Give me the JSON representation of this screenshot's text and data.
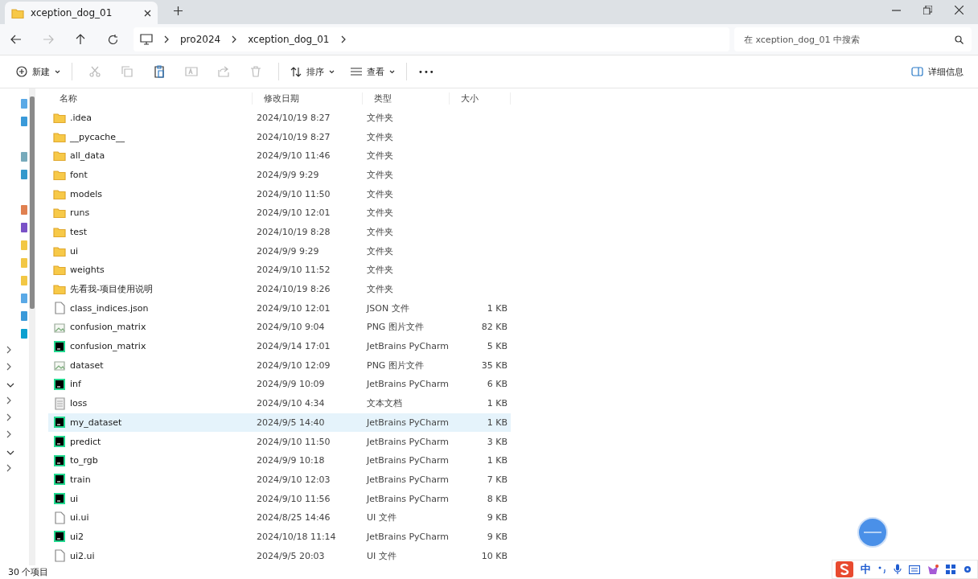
{
  "window": {
    "tab_title": "xception_dog_01"
  },
  "breadcrumb": [
    "pro2024",
    "xception_dog_01"
  ],
  "search": {
    "placeholder": "在 xception_dog_01 中搜索"
  },
  "toolbar": {
    "new": "新建",
    "sort": "排序",
    "view": "查看",
    "more": "•••",
    "details": "详细信息"
  },
  "columns": [
    "名称",
    "修改日期",
    "类型",
    "大小"
  ],
  "rows": [
    {
      "kind": "folder",
      "name": ".idea",
      "date": "2024/10/19 8:27",
      "type": "文件夹",
      "size": "",
      "selected": false
    },
    {
      "kind": "folder",
      "name": "__pycache__",
      "date": "2024/10/19 8:27",
      "type": "文件夹",
      "size": "",
      "selected": false
    },
    {
      "kind": "folder",
      "name": "all_data",
      "date": "2024/9/10 11:46",
      "type": "文件夹",
      "size": "",
      "selected": false
    },
    {
      "kind": "folder",
      "name": "font",
      "date": "2024/9/9 9:29",
      "type": "文件夹",
      "size": "",
      "selected": false
    },
    {
      "kind": "folder",
      "name": "models",
      "date": "2024/9/10 11:50",
      "type": "文件夹",
      "size": "",
      "selected": false
    },
    {
      "kind": "folder",
      "name": "runs",
      "date": "2024/9/10 12:01",
      "type": "文件夹",
      "size": "",
      "selected": false
    },
    {
      "kind": "folder",
      "name": "test",
      "date": "2024/10/19 8:28",
      "type": "文件夹",
      "size": "",
      "selected": false
    },
    {
      "kind": "folder",
      "name": "ui",
      "date": "2024/9/9 9:29",
      "type": "文件夹",
      "size": "",
      "selected": false
    },
    {
      "kind": "folder",
      "name": "weights",
      "date": "2024/9/10 11:52",
      "type": "文件夹",
      "size": "",
      "selected": false
    },
    {
      "kind": "folder",
      "name": "先看我-项目使用说明",
      "date": "2024/10/19 8:26",
      "type": "文件夹",
      "size": "",
      "selected": false
    },
    {
      "kind": "file",
      "name": "class_indices.json",
      "date": "2024/9/10 12:01",
      "type": "JSON 文件",
      "size": "1 KB",
      "selected": false
    },
    {
      "kind": "image",
      "name": "confusion_matrix",
      "date": "2024/9/10 9:04",
      "type": "PNG 图片文件",
      "size": "82 KB",
      "selected": false
    },
    {
      "kind": "python",
      "name": "confusion_matrix",
      "date": "2024/9/14 17:01",
      "type": "JetBrains PyCharm",
      "size": "5 KB",
      "selected": false
    },
    {
      "kind": "image",
      "name": "dataset",
      "date": "2024/9/10 12:09",
      "type": "PNG 图片文件",
      "size": "35 KB",
      "selected": false
    },
    {
      "kind": "python",
      "name": "inf",
      "date": "2024/9/9 10:09",
      "type": "JetBrains PyCharm",
      "size": "6 KB",
      "selected": false
    },
    {
      "kind": "text",
      "name": "loss",
      "date": "2024/9/10 4:34",
      "type": "文本文档",
      "size": "1 KB",
      "selected": false
    },
    {
      "kind": "python",
      "name": "my_dataset",
      "date": "2024/9/5 14:40",
      "type": "JetBrains PyCharm",
      "size": "1 KB",
      "selected": true
    },
    {
      "kind": "python",
      "name": "predict",
      "date": "2024/9/10 11:50",
      "type": "JetBrains PyCharm",
      "size": "3 KB",
      "selected": false
    },
    {
      "kind": "python",
      "name": "to_rgb",
      "date": "2024/9/9 10:18",
      "type": "JetBrains PyCharm",
      "size": "1 KB",
      "selected": false
    },
    {
      "kind": "python",
      "name": "train",
      "date": "2024/9/10 12:03",
      "type": "JetBrains PyCharm",
      "size": "7 KB",
      "selected": false
    },
    {
      "kind": "python",
      "name": "ui",
      "date": "2024/9/10 11:56",
      "type": "JetBrains PyCharm",
      "size": "8 KB",
      "selected": false
    },
    {
      "kind": "file",
      "name": "ui.ui",
      "date": "2024/8/25 14:46",
      "type": "UI 文件",
      "size": "9 KB",
      "selected": false
    },
    {
      "kind": "python",
      "name": "ui2",
      "date": "2024/10/18 11:14",
      "type": "JetBrains PyCharm",
      "size": "9 KB",
      "selected": false
    },
    {
      "kind": "file",
      "name": "ui2.ui",
      "date": "2024/9/5 20:03",
      "type": "UI 文件",
      "size": "10 KB",
      "selected": false
    }
  ],
  "status_bar": {
    "item_count": "30 个项目"
  },
  "ime_bar": {
    "mode": "中"
  }
}
